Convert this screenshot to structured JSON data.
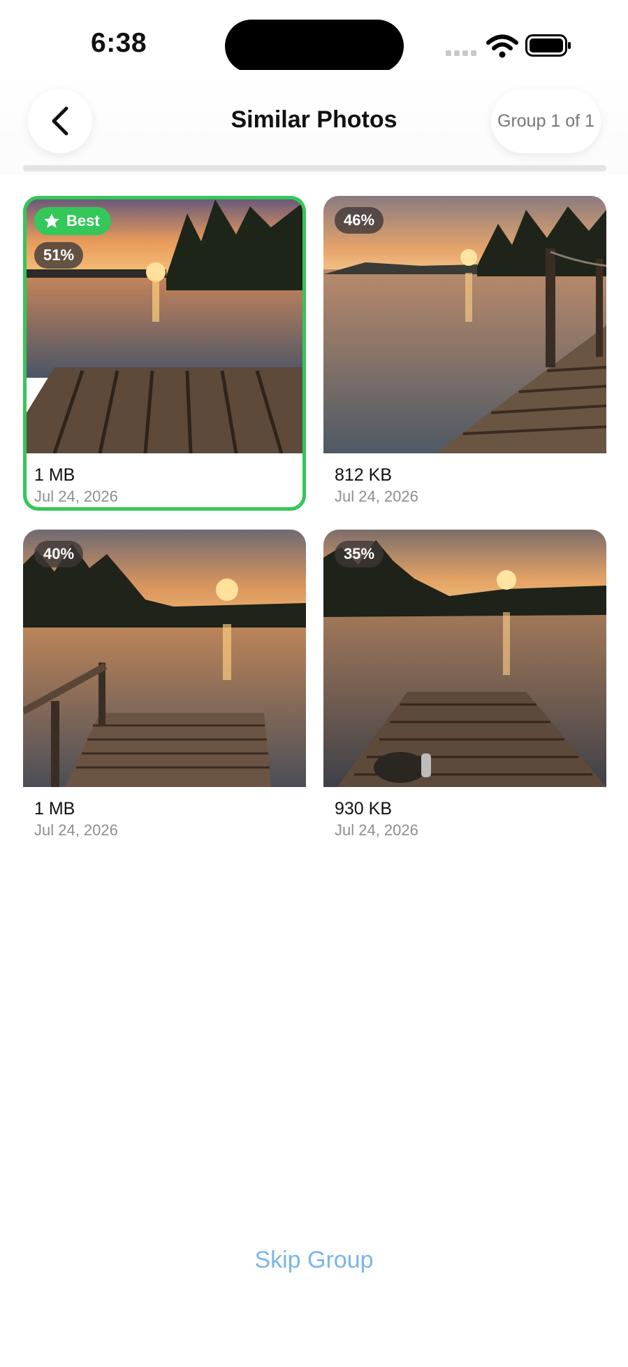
{
  "status": {
    "time": "6:38"
  },
  "header": {
    "title": "Similar Photos",
    "group_label": "Group 1 of 1",
    "progress": 1.0
  },
  "best_label": "Best",
  "photos": [
    {
      "similarity": "51%",
      "size": "1 MB",
      "date": "Jul 24, 2026",
      "best": true
    },
    {
      "similarity": "46%",
      "size": "812 KB",
      "date": "Jul 24, 2026",
      "best": false
    },
    {
      "similarity": "40%",
      "size": "1 MB",
      "date": "Jul 24, 2026",
      "best": false
    },
    {
      "similarity": "35%",
      "size": "930 KB",
      "date": "Jul 24, 2026",
      "best": false
    }
  ],
  "footer": {
    "skip_label": "Skip Group"
  },
  "colors": {
    "accent_green": "#34c759",
    "skip_blue": "#7ab6ea"
  }
}
